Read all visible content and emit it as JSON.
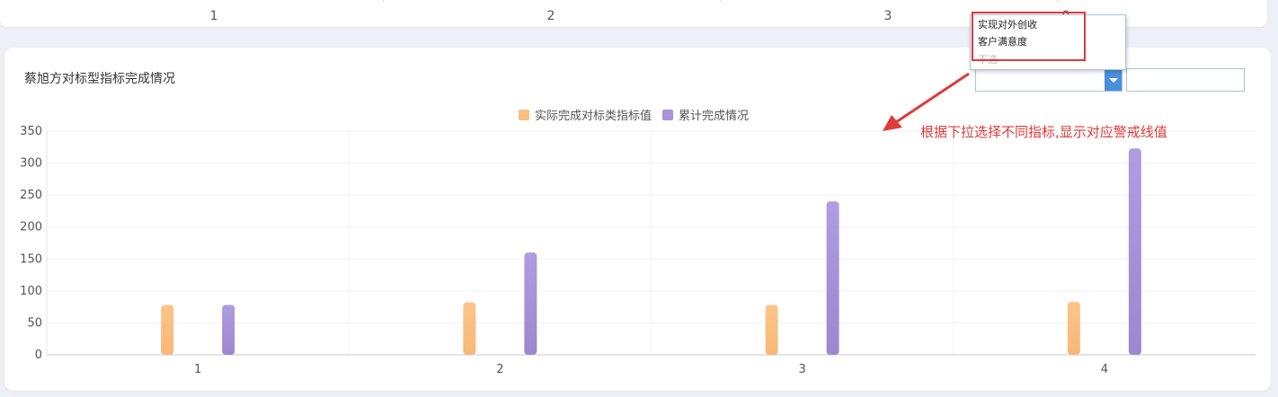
{
  "top_axis": {
    "labels": [
      "1",
      "2",
      "3",
      "0"
    ]
  },
  "card": {
    "title": "蔡旭方对标型指标完成情况"
  },
  "dropdown": {
    "options": [
      "实现对外创收",
      "客户满意度"
    ],
    "hint": "不选"
  },
  "annotation": {
    "text": "根据下拉选择不同指标,显示对应警戒线值"
  },
  "colors": {
    "series1": "#fbbf7f",
    "series2": "#a993d9",
    "highlight": "#e03a3a",
    "select_arrow": "#4a90d9"
  },
  "chart_data": {
    "type": "bar",
    "title": "",
    "xlabel": "",
    "ylabel": "",
    "categories": [
      "1",
      "2",
      "3",
      "4"
    ],
    "ylim": [
      0,
      350
    ],
    "yticks": [
      0,
      50,
      100,
      150,
      200,
      250,
      300,
      350
    ],
    "grid": true,
    "legend_position": "top-center",
    "series": [
      {
        "name": "实际完成对标类指标值",
        "values": [
          78,
          82,
          78,
          83
        ]
      },
      {
        "name": "累计完成情况",
        "values": [
          78,
          160,
          240,
          323
        ]
      }
    ]
  }
}
